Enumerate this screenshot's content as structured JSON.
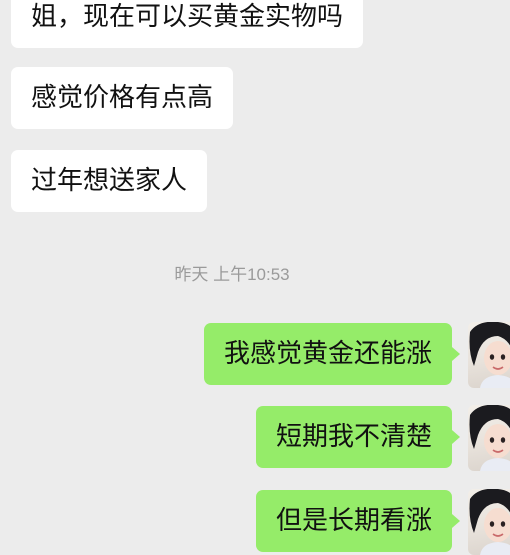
{
  "chat": {
    "incoming": [
      {
        "text": "姐，现在可以买黄金实物吗"
      },
      {
        "text": "感觉价格有点高"
      },
      {
        "text": "过年想送家人"
      }
    ],
    "timestamp": "昨天 上午10:53",
    "outgoing": [
      {
        "text": "我感觉黄金还能涨"
      },
      {
        "text": "短期我不清楚"
      },
      {
        "text": "但是长期看涨"
      }
    ]
  },
  "colors": {
    "background": "#ececec",
    "incoming_bubble": "#ffffff",
    "outgoing_bubble": "#95ec69",
    "timestamp": "#9a9a9a"
  },
  "icons": {
    "avatar": "user-avatar-photo"
  }
}
